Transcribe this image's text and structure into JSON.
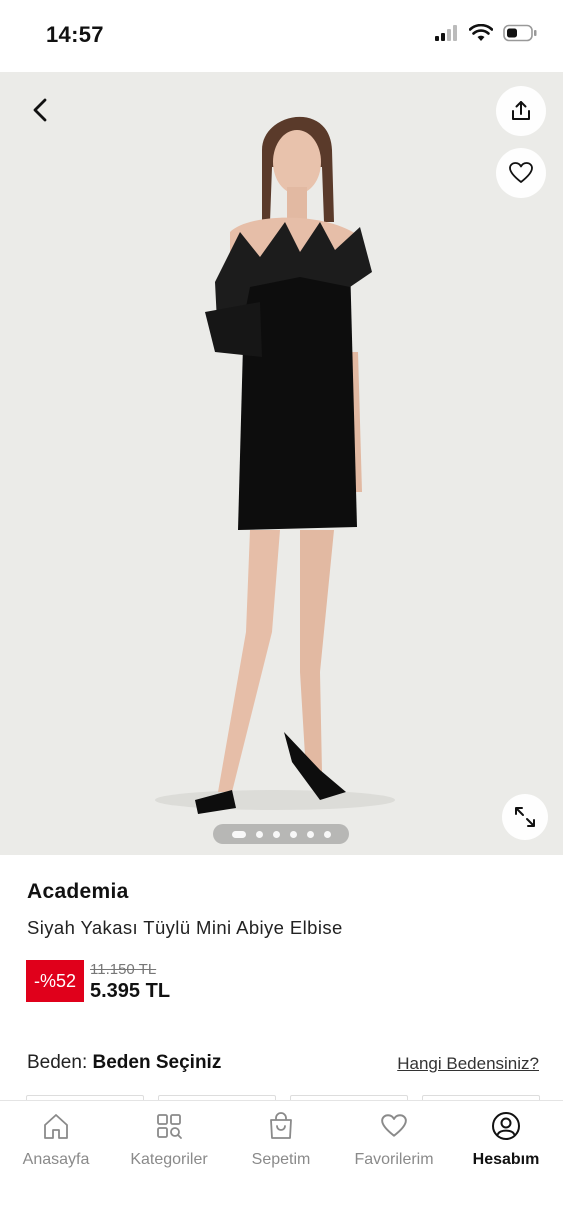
{
  "status_bar": {
    "time": "14:57",
    "icons": [
      "cellular-signal-icon",
      "wifi-icon",
      "battery-icon"
    ]
  },
  "gallery": {
    "image_count": 6,
    "active_index": 0,
    "icons": [
      "back-chevron-icon",
      "share-icon",
      "heart-icon",
      "expand-icon"
    ]
  },
  "product": {
    "brand": "Academia",
    "name": "Siyah Yakası Tüylü Mini Abiye Elbise",
    "discount": "-%52",
    "old_price": "11.150 TL",
    "price": "5.395 TL"
  },
  "size": {
    "label": "Beden:",
    "value": "Beden Seçiniz",
    "help_link": "Hangi Bedensiniz?"
  },
  "bottom_nav": {
    "items": [
      {
        "label": "Anasayfa",
        "icon": "home-icon"
      },
      {
        "label": "Kategoriler",
        "icon": "categories-icon"
      },
      {
        "label": "Sepetim",
        "icon": "bag-icon"
      },
      {
        "label": "Favorilerim",
        "icon": "heart-icon"
      },
      {
        "label": "Hesabım",
        "icon": "account-icon",
        "active": true
      }
    ]
  },
  "colors": {
    "discount_badge": "#e0001b",
    "image_background": "#ebebe8",
    "inactive_nav": "#8a8a8a"
  }
}
